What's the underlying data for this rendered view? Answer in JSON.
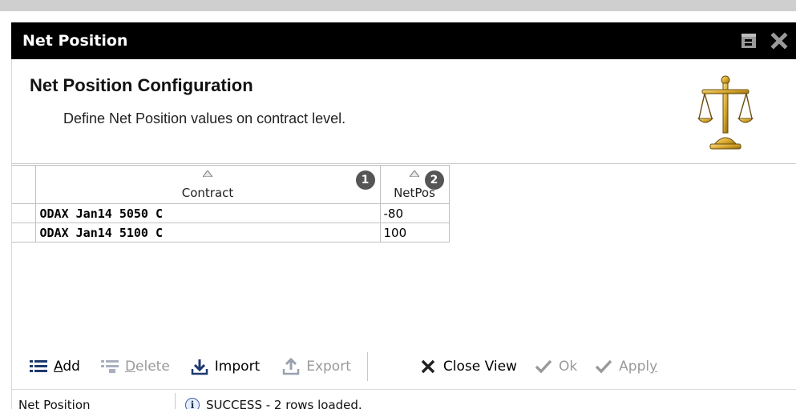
{
  "window": {
    "title": "Net Position"
  },
  "header": {
    "title": "Net Position Configuration",
    "subtitle": "Define Net Position values on contract level.",
    "icon": "scales-of-justice-icon"
  },
  "grid": {
    "columns": [
      {
        "label": "Contract",
        "badge": "1"
      },
      {
        "label": "NetPos",
        "badge": "2"
      }
    ],
    "rows": [
      {
        "contract": "ODAX Jan14 5050 C",
        "netpos": "-80"
      },
      {
        "contract": "ODAX Jan14 5100 C",
        "netpos": "100"
      }
    ]
  },
  "toolbar": {
    "add": {
      "label": "Add",
      "mnemonic": "A",
      "rest": "dd"
    },
    "delete": {
      "label": "Delete",
      "first": "D",
      "rest": "elete",
      "enabled": false
    },
    "import": {
      "label": "Import"
    },
    "export": {
      "label": "Export",
      "enabled": false
    },
    "close_view": {
      "label": "Close View"
    },
    "ok": {
      "label": "Ok",
      "enabled": false
    },
    "apply": {
      "label": "Apply",
      "lead": "Appl",
      "mnemonic": "y",
      "enabled": false
    }
  },
  "status": {
    "left": "Net Position",
    "message": "SUCCESS - 2 rows loaded."
  },
  "colors": {
    "titlebar": "#000000",
    "disabled": "#9a9a9a",
    "badge": "#555555"
  }
}
